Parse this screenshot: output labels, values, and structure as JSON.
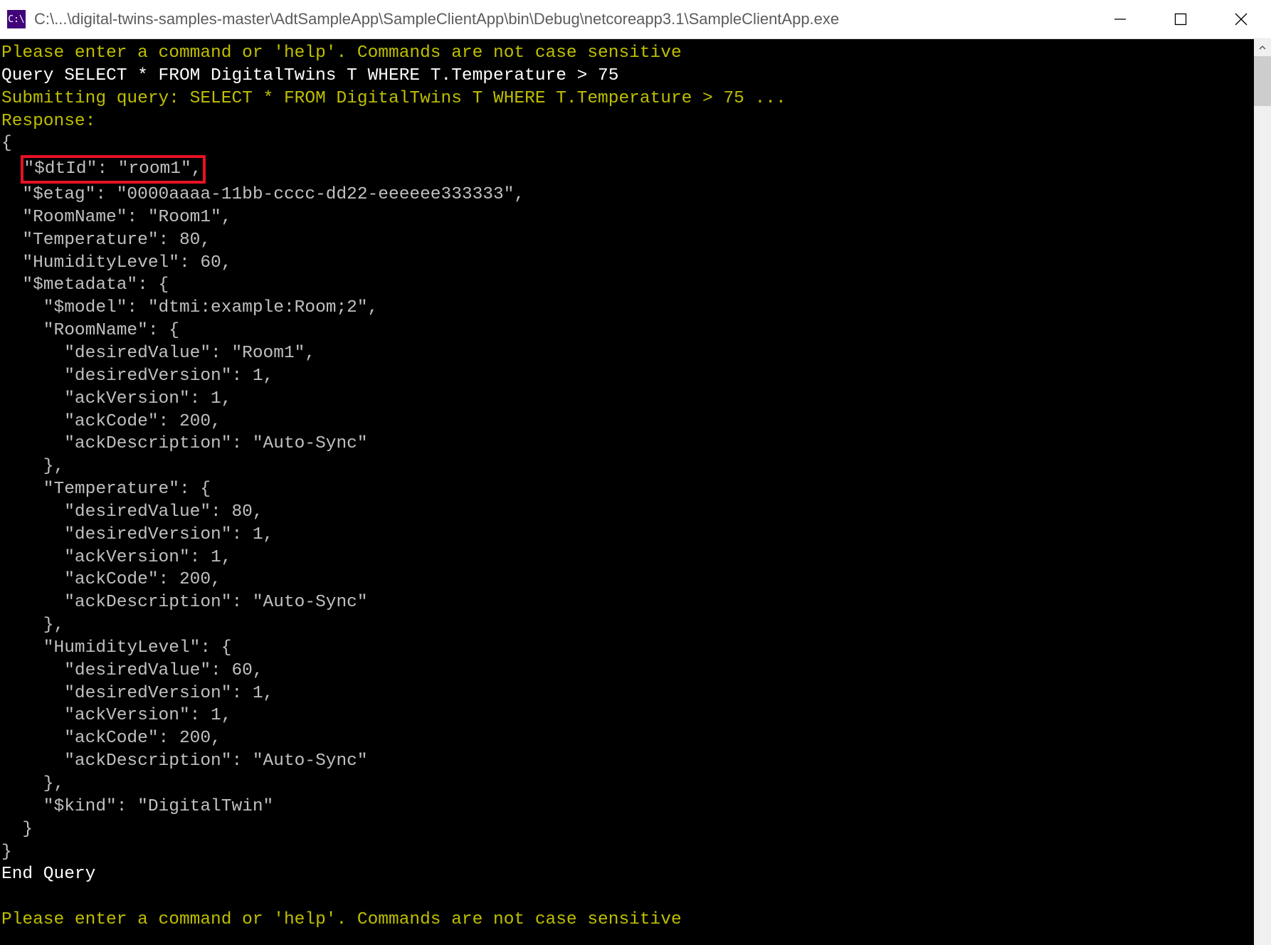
{
  "titlebar": {
    "icon_label": "C:\\",
    "path": "C:\\...\\digital-twins-samples-master\\AdtSampleApp\\SampleClientApp\\bin\\Debug\\netcoreapp3.1\\SampleClientApp.exe"
  },
  "console": {
    "prompt1": "Please enter a command or 'help'. Commands are not case sensitive",
    "input_line": "Query SELECT * FROM DigitalTwins T WHERE T.Temperature > 75",
    "submitting": "Submitting query: SELECT * FROM DigitalTwins T WHERE T.Temperature > 75 ...",
    "response_label": "Response:",
    "brace_open": "{",
    "dtid_line": "\"$dtId\": \"room1\",",
    "etag_line": "  \"$etag\": \"0000aaaa-11bb-cccc-dd22-eeeeee333333\",",
    "roomname_line": "  \"RoomName\": \"Room1\",",
    "temperature_line": "  \"Temperature\": 80,",
    "humidity_line": "  \"HumidityLevel\": 60,",
    "metadata_open": "  \"$metadata\": {",
    "model_line": "    \"$model\": \"dtmi:example:Room;2\",",
    "m_roomname_open": "    \"RoomName\": {",
    "m_rn_dv": "      \"desiredValue\": \"Room1\",",
    "m_rn_dver": "      \"desiredVersion\": 1,",
    "m_rn_av": "      \"ackVersion\": 1,",
    "m_rn_ac": "      \"ackCode\": 200,",
    "m_rn_ad": "      \"ackDescription\": \"Auto-Sync\"",
    "m_rn_close": "    },",
    "m_temp_open": "    \"Temperature\": {",
    "m_t_dv": "      \"desiredValue\": 80,",
    "m_t_dver": "      \"desiredVersion\": 1,",
    "m_t_av": "      \"ackVersion\": 1,",
    "m_t_ac": "      \"ackCode\": 200,",
    "m_t_ad": "      \"ackDescription\": \"Auto-Sync\"",
    "m_t_close": "    },",
    "m_hum_open": "    \"HumidityLevel\": {",
    "m_h_dv": "      \"desiredValue\": 60,",
    "m_h_dver": "      \"desiredVersion\": 1,",
    "m_h_av": "      \"ackVersion\": 1,",
    "m_h_ac": "      \"ackCode\": 200,",
    "m_h_ad": "      \"ackDescription\": \"Auto-Sync\"",
    "m_h_close": "    },",
    "kind_line": "    \"$kind\": \"DigitalTwin\"",
    "metadata_close": "  }",
    "brace_close": "}",
    "end_query": "End Query",
    "blank": "",
    "prompt2": "Please enter a command or 'help'. Commands are not case sensitive"
  }
}
